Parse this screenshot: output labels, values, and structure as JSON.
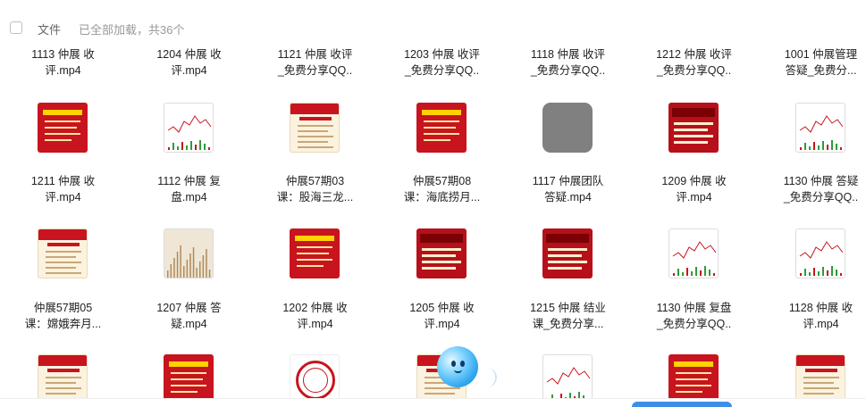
{
  "header": {
    "title": "文件",
    "status": "已全部加载，共36个"
  },
  "rows": [
    {
      "tiles": [
        {
          "name_lines": [
            "1113 仲展 收",
            "评.mp4"
          ],
          "thumb": "none"
        },
        {
          "name_lines": [
            "1204 仲展 收",
            "评.mp4"
          ],
          "thumb": "none"
        },
        {
          "name_lines": [
            "1121 仲展 收评",
            "_免费分享QQ.."
          ],
          "thumb": "none"
        },
        {
          "name_lines": [
            "1203 仲展 收评",
            "_免费分享QQ.."
          ],
          "thumb": "none"
        },
        {
          "name_lines": [
            "1118 仲展 收评",
            "_免费分享QQ.."
          ],
          "thumb": "none"
        },
        {
          "name_lines": [
            "1212 仲展 收评",
            "_免费分享QQ.."
          ],
          "thumb": "none"
        },
        {
          "name_lines": [
            "1001 仲展管理",
            "答疑_免费分..."
          ],
          "thumb": "none"
        }
      ]
    },
    {
      "tiles": [
        {
          "name_lines": [
            "1211 仲展 收",
            "评.mp4"
          ],
          "thumb": "red"
        },
        {
          "name_lines": [
            "1112 仲展 复",
            "盘.mp4"
          ],
          "thumb": "chart"
        },
        {
          "name_lines": [
            "仲展57期03",
            "课：股海三龙..."
          ],
          "thumb": "cream"
        },
        {
          "name_lines": [
            "仲展57期08",
            "课：海底捞月..."
          ],
          "thumb": "red"
        },
        {
          "name_lines": [
            "1117 仲展团队",
            "答疑.mp4"
          ],
          "thumb": "grey"
        },
        {
          "name_lines": [
            "1209 仲展 收",
            "评.mp4"
          ],
          "thumb": "brush"
        },
        {
          "name_lines": [
            "1130 仲展 答疑",
            "_免费分享QQ.."
          ],
          "thumb": "chart"
        }
      ]
    },
    {
      "tiles": [
        {
          "name_lines": [
            "仲展57期05",
            "课：嫦娥奔月..."
          ],
          "thumb": "cream"
        },
        {
          "name_lines": [
            "1207 仲展 答",
            "疑.mp4"
          ],
          "thumb": "bars"
        },
        {
          "name_lines": [
            "1202 仲展 收",
            "评.mp4"
          ],
          "thumb": "red"
        },
        {
          "name_lines": [
            "1205 仲展 收",
            "评.mp4"
          ],
          "thumb": "brush"
        },
        {
          "name_lines": [
            "1215 仲展 结业",
            "课_免费分享..."
          ],
          "thumb": "brush"
        },
        {
          "name_lines": [
            "1130 仲展 复盘",
            "_免费分享QQ.."
          ],
          "thumb": "chart"
        },
        {
          "name_lines": [
            "1128 仲展 收",
            "评.mp4"
          ],
          "thumb": "chart"
        }
      ]
    },
    {
      "tiles": [
        {
          "name_lines": [],
          "thumb": "cream"
        },
        {
          "name_lines": [],
          "thumb": "red"
        },
        {
          "name_lines": [],
          "thumb": "seal"
        },
        {
          "name_lines": [],
          "thumb": "cream"
        },
        {
          "name_lines": [],
          "thumb": "chart"
        },
        {
          "name_lines": [],
          "thumb": "red"
        },
        {
          "name_lines": [],
          "thumb": "cream"
        }
      ]
    }
  ],
  "colors": {
    "accent_red": "#c8141e",
    "accent_blue": "#3d8ee6",
    "text": "#222222",
    "muted": "#999999"
  }
}
